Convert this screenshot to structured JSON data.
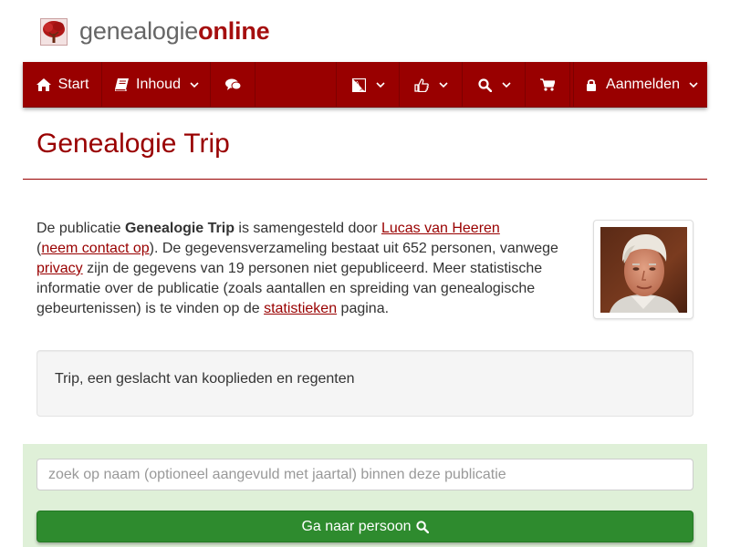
{
  "brand": {
    "part1": "genealogie",
    "part2": "online"
  },
  "colors": {
    "brand": "#990000",
    "success": "#2e8b2e",
    "panel": "#dff0d8"
  },
  "nav": {
    "start": {
      "icon": "home-icon",
      "label": "Start"
    },
    "inhoud": {
      "icon": "book-icon",
      "label": "Inhoud"
    },
    "chat": {
      "icon": "comments-icon"
    },
    "language": {
      "icon": "language-icon"
    },
    "like": {
      "icon": "thumbs-up-icon"
    },
    "search": {
      "icon": "search-icon"
    },
    "cart": {
      "icon": "shopping-cart-icon"
    },
    "login": {
      "icon": "lock-icon",
      "label": "Aanmelden"
    }
  },
  "page": {
    "title": "Genealogie Trip"
  },
  "intro": {
    "t1": "De publicatie ",
    "pub_name": "Genealogie Trip",
    "t2": " is samengesteld door ",
    "author": "Lucas van Heeren",
    "t3": "(",
    "contact": "neem contact op",
    "t4": "). De gegevensverzameling bestaat uit 652 personen, vanwege ",
    "privacy": "privacy",
    "t5": " zijn de gegevens van 19 personen niet gepubliceerd. Meer statistische informatie over de publicatie (zoals aantallen en spreiding van genealogische gebeurtenissen) is te vinden op de ",
    "stats": "statistieken",
    "t6": " pagina."
  },
  "description": "Trip, een geslacht van kooplieden en regenten",
  "search": {
    "placeholder": "zoek op naam (optioneel aangevuld met jaartal) binnen deze publicatie",
    "value": "",
    "button_label": "Ga naar persoon",
    "button_icon": "search-icon"
  }
}
